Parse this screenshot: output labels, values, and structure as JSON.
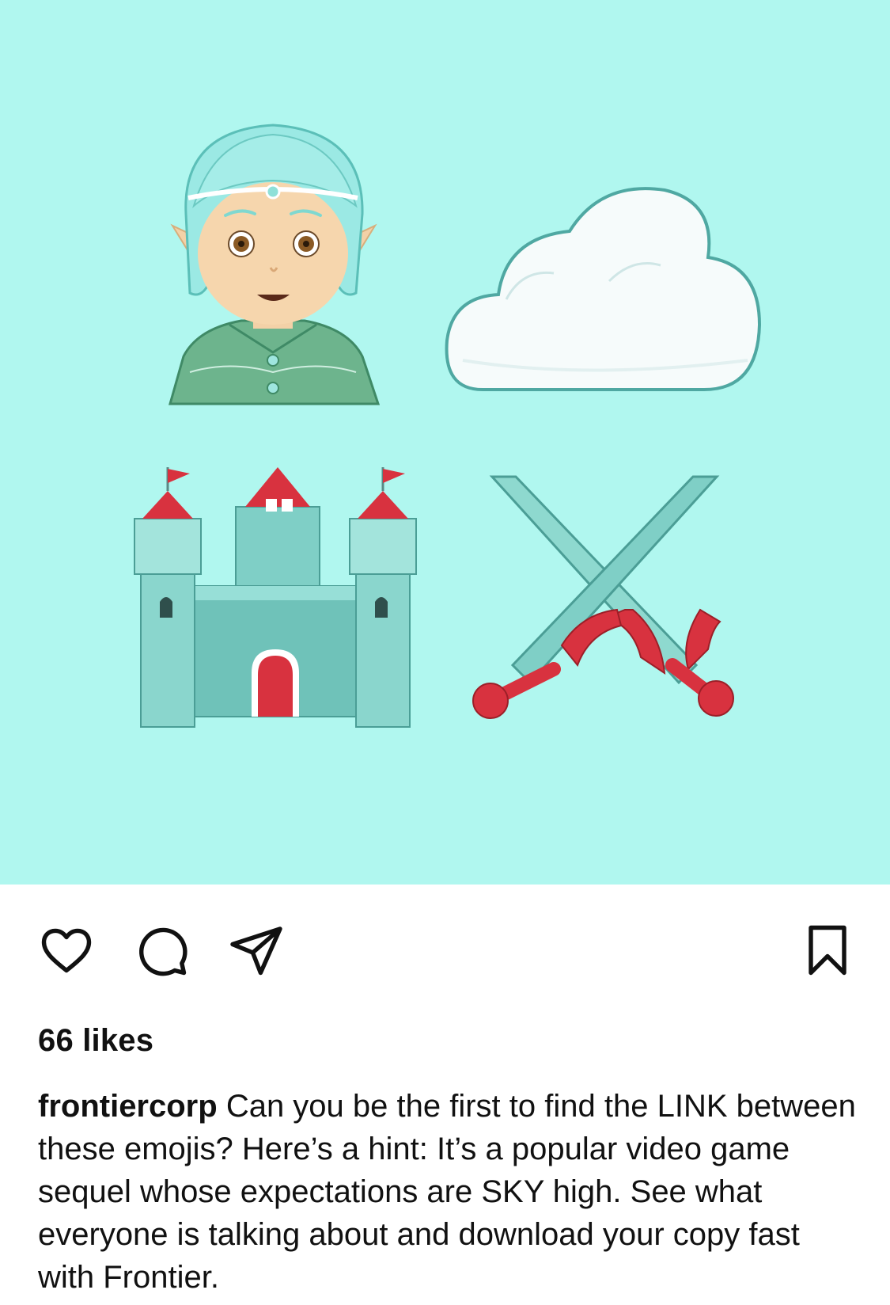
{
  "post": {
    "image_alt_emojis": [
      "elf-emoji",
      "cloud-emoji",
      "castle-emoji",
      "crossed-swords-emoji"
    ],
    "background_color": "#b0f7ef"
  },
  "actions": {
    "like_icon": "heart-icon",
    "comment_icon": "comment-icon",
    "share_icon": "paper-plane-icon",
    "save_icon": "bookmark-icon"
  },
  "likes": {
    "text": "66 likes"
  },
  "caption": {
    "username": "frontiercorp",
    "text": "Can you be the first to find the LINK between these emojis? Here’s a hint: It’s a popular video game sequel whose expectations are SKY high. See what everyone is talking about and download your copy fast with Frontier."
  }
}
